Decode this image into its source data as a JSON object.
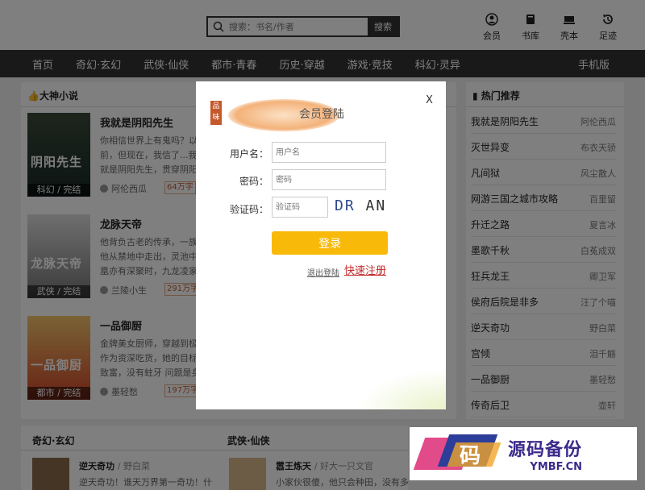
{
  "header": {
    "search_placeholder": "搜索：书名/作者",
    "search_button": "搜索",
    "icons": [
      {
        "label": "会员",
        "icon": "user-icon"
      },
      {
        "label": "书库",
        "icon": "book-icon"
      },
      {
        "label": "壳本",
        "icon": "shelf-icon"
      },
      {
        "label": "足迹",
        "icon": "history-icon"
      }
    ]
  },
  "nav": {
    "items": [
      "首页",
      "奇幻·玄幻",
      "武侠·仙侠",
      "都市·青春",
      "历史·穿越",
      "游戏·竞技",
      "科幻·灵异"
    ],
    "mobile": "手机版"
  },
  "left_section": {
    "title": "大神小说",
    "books": [
      {
        "title": "我就是阴阳先生",
        "desc": "你相信世界上有鬼吗？以前，但现在，我信了...我就是阴阳先生，贯穿阴阳的人注意",
        "author": "阿伦西瓜",
        "words": "64万字",
        "cover_tag": "科幻 / 完结",
        "cover_title": "阴阳先生"
      },
      {
        "title": "龙脉天帝",
        "desc": "他背负古老的传承，一族他从禁地中走出，灵池中凰亦有深聚时，九龙凌家",
        "author": "兰陵小生",
        "words": "291万字",
        "cover_tag": "武侠 / 完结",
        "cover_title": "龙脉天帝"
      },
      {
        "title": "一品御厨",
        "desc": "金牌美女厨师，穿越到极作为资深吃货，她的目标致富，没有蛀牙 问题是身",
        "author": "墨轻愁",
        "words": "197万字",
        "cover_tag": "都市 / 完结",
        "cover_title": "一品御厨"
      }
    ]
  },
  "right_section": {
    "title": "热门推荐",
    "items": [
      {
        "name": "我就是阴阳先生",
        "author": "阿伦西瓜"
      },
      {
        "name": "灭世异变",
        "author": "布衣天骄"
      },
      {
        "name": "凡间狱",
        "author": "风尘散人"
      },
      {
        "name": "网游三国之城市攻略",
        "author": "百里留"
      },
      {
        "name": "升迁之路",
        "author": "夏言冰"
      },
      {
        "name": "墨歌千秋",
        "author": "白菟成双"
      },
      {
        "name": "狂兵龙王",
        "author": "卿卫军"
      },
      {
        "name": "侯府后院是非多",
        "author": "汪了个喵"
      },
      {
        "name": "逆天奇功",
        "author": "野白菜"
      },
      {
        "name": "宫倾",
        "author": "泪千觞"
      },
      {
        "name": "一品御厨",
        "author": "墨轻愁"
      },
      {
        "name": "传奇后卫",
        "author": "壶轩"
      }
    ]
  },
  "bottom": {
    "col1_title": "奇幻·玄幻",
    "col2_title": "武侠·仙侠",
    "item1": {
      "title": "逆天奇功",
      "author": "/ 野白菜",
      "desc": "逆天奇功！谁天万界第一奇功！什"
    },
    "item2": {
      "title": "嚣王炼天",
      "author": "/ 好大一只文官",
      "desc": "小家伙很傻，他只会种田，没有多"
    }
  },
  "modal": {
    "seal": "品味",
    "title": "会员登陆",
    "close": "X",
    "username_label": "用户名：",
    "username_placeholder": "用户名",
    "password_label": "密码：",
    "password_placeholder": "密码",
    "captcha_label": "验证码：",
    "captcha_placeholder": "验证码",
    "captcha_text_a": "DR",
    "captcha_text_b": " AN",
    "login_button": "登录",
    "logout_link": "退出登陆",
    "register_link": "快速注册"
  },
  "watermark": {
    "logo_char": "码",
    "title": "源码备份",
    "domain": "YMBF.CN"
  },
  "colors": {
    "nav_bg": "#333333",
    "login_button": "#f9b908",
    "register_link": "#c4282b"
  }
}
